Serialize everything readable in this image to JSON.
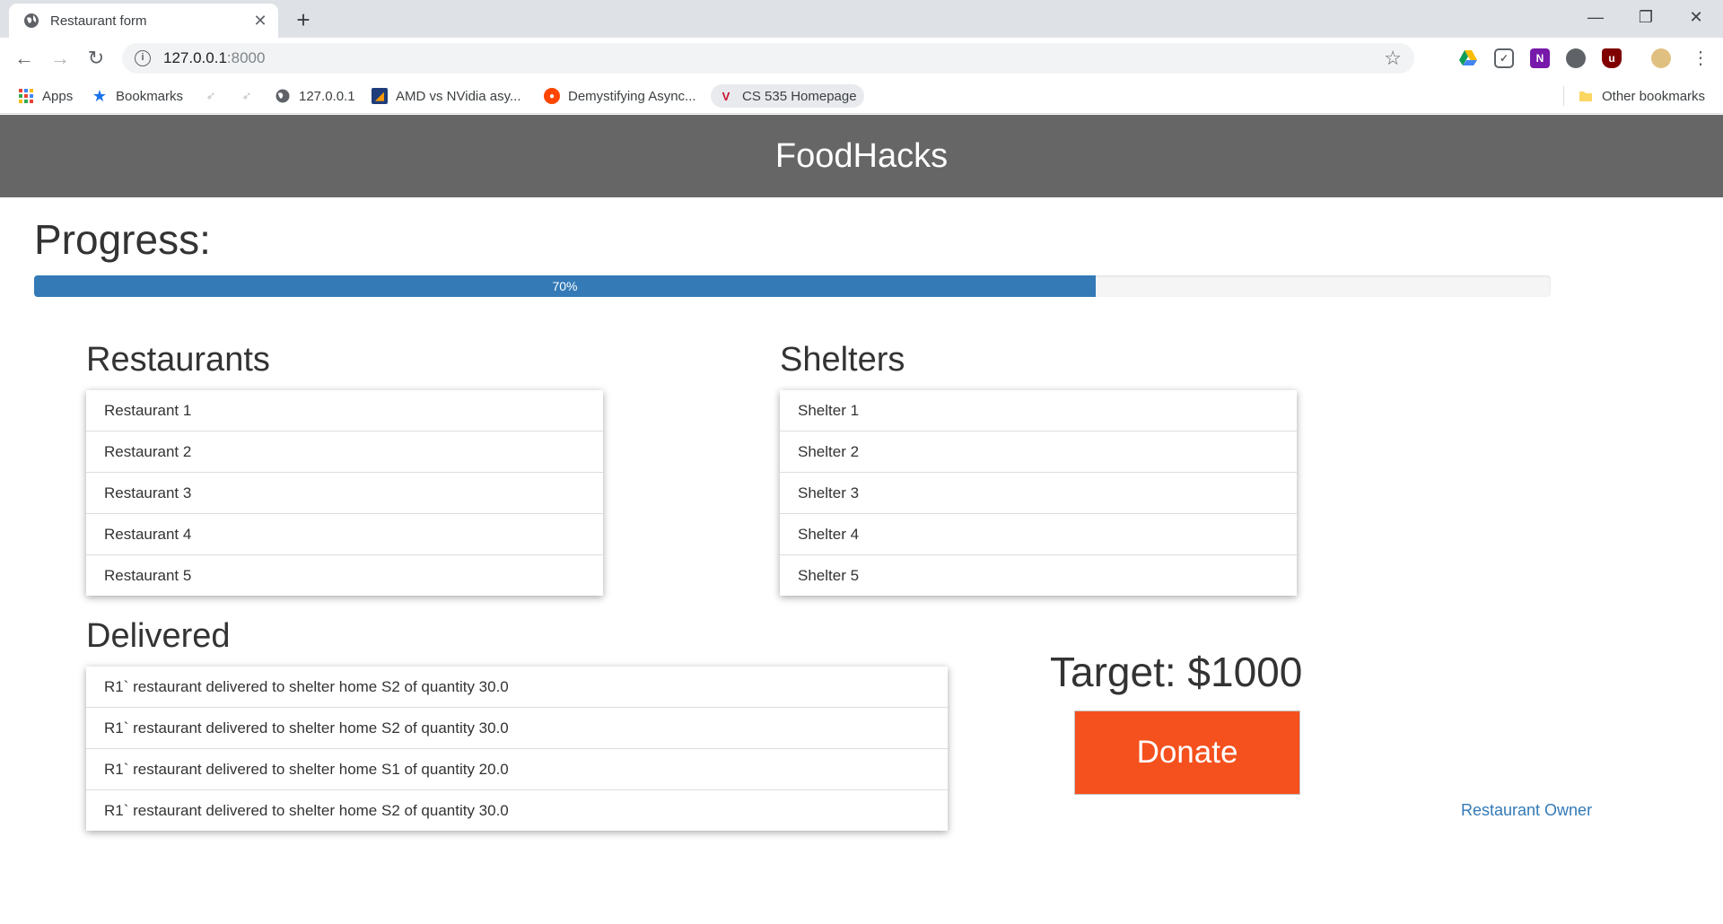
{
  "browser": {
    "tab_title": "Restaurant form",
    "url_host": "127.0.0.1",
    "url_port": ":8000",
    "bookmarks": [
      {
        "label": "Apps",
        "icon": "apps-grid-icon"
      },
      {
        "label": "Bookmarks",
        "icon": "star-icon"
      },
      {
        "label": "127.0.0.1",
        "icon": "globe-icon"
      },
      {
        "label": "AMD vs NVidia asy...",
        "icon": "site-icon"
      },
      {
        "label": "Demystifying Async...",
        "icon": "reddit-icon"
      },
      {
        "label": "CS 535 Homepage",
        "icon": "site-icon"
      }
    ],
    "other_bookmarks": "Other bookmarks"
  },
  "header": {
    "title": "FoodHacks"
  },
  "progress": {
    "title": "Progress:",
    "value": 70,
    "label": "70%"
  },
  "restaurants": {
    "title": "Restaurants",
    "items": [
      "Restaurant 1",
      "Restaurant 2",
      "Restaurant 3",
      "Restaurant 4",
      "Restaurant 5"
    ]
  },
  "shelters": {
    "title": "Shelters",
    "items": [
      "Shelter 1",
      "Shelter 2",
      "Shelter 3",
      "Shelter 4",
      "Shelter 5"
    ]
  },
  "delivered": {
    "title": "Delivered",
    "items": [
      "R1` restaurant delivered to shelter home S2 of quantity 30.0",
      "R1` restaurant delivered to shelter home S2 of quantity 30.0",
      "R1` restaurant delivered to shelter home S1 of quantity 20.0",
      "R1` restaurant delivered to shelter home S2 of quantity 30.0"
    ]
  },
  "donation": {
    "target": "Target: $1000",
    "button": "Donate"
  },
  "footer": {
    "owner_link": "Restaurant Owner"
  },
  "colors": {
    "header_bg": "#666666",
    "progress": "#337ab7",
    "donate": "#f4511e",
    "link": "#337ab7"
  }
}
